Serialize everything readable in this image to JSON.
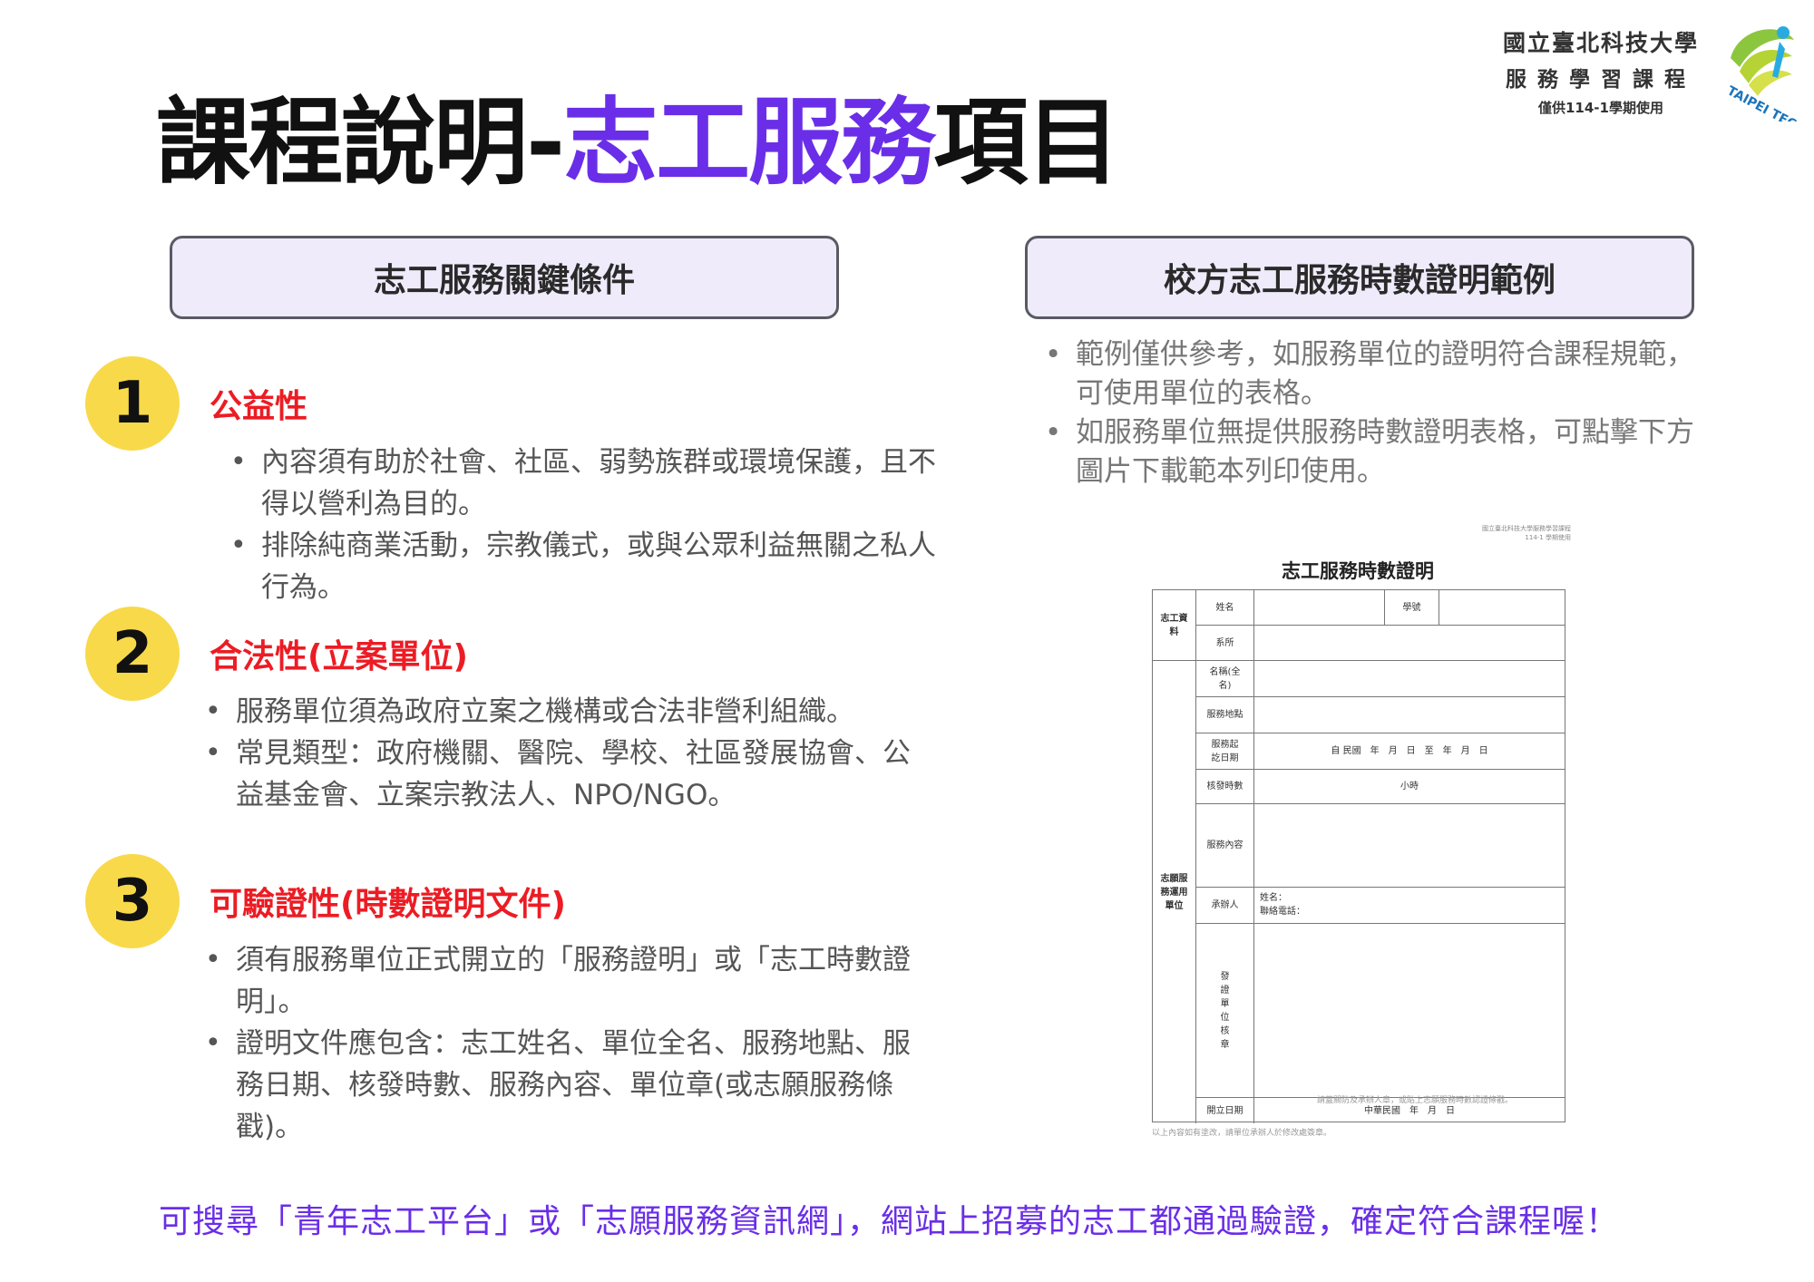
{
  "logo": {
    "line1": "國立臺北科技大學",
    "line2": "服務學習課程",
    "line3": "僅供114-1學期使用",
    "brand": "TAIPEI TECH"
  },
  "title": {
    "part1": "課程說明-",
    "part2": "志工服務",
    "part3": "項目"
  },
  "left_header": "志工服務關鍵條件",
  "right_header": "校方志工服務時數證明範例",
  "items": [
    {
      "number": "1",
      "title": "公益性",
      "bullets": [
        "內容須有助於社會、社區、弱勢族群或環境保護，且不得以營利為目的。",
        "排除純商業活動，宗教儀式，或與公眾利益無關之私人行為。"
      ]
    },
    {
      "number": "2",
      "title": "合法性(立案單位)",
      "bullets": [
        "服務單位須為政府立案之機構或合法非營利組織。",
        "常見類型：政府機關、醫院、學校、社區發展協會、公益基金會、立案宗教法人、NPO/NGO。"
      ]
    },
    {
      "number": "3",
      "title": "可驗證性(時數證明文件)",
      "bullets": [
        "須有服務單位正式開立的「服務證明」或「志工時數證明」。",
        "證明文件應包含：志工姓名、單位全名、服務地點、服務日期、核發時數、服務內容、單位章(或志願服務條戳)。"
      ]
    }
  ],
  "notes": [
    "範例僅供參考，如服務單位的證明符合課程規範，可使用單位的表格。",
    "如服務單位無提供服務時數證明表格，可點擊下方圖片下載範本列印使用。"
  ],
  "certificate": {
    "corner_line1": "國立臺北科技大學服務學習課程",
    "corner_line2": "114-1 學期使用",
    "title": "志工服務時數證明",
    "section_volunteer": "志工資料",
    "section_unit": "志願服務運用單位",
    "name_label": "姓名",
    "student_id_label": "學號",
    "dept_label": "系所",
    "unit_name_label": "名稱(全名)",
    "location_label": "服務地點",
    "dates_label": "服務起訖日期",
    "dates_value": "自 民國　年　月　日　至　年　月　日",
    "hours_label": "核發時數",
    "hours_value": "小時",
    "content_label": "服務內容",
    "contact_label": "承辦人",
    "contact_value1": "姓名：",
    "contact_value2": "聯絡電話：",
    "seal_label": "發證單位核章",
    "seal_note": "請蓋關防及承辦人章，或貼上志願服務時數認證條戳。",
    "issue_date_label": "開立日期",
    "issue_date_value": "中華民國　年　月　日",
    "footer": "以上內容如有塗改，請單位承辦人於修改處簽章。"
  },
  "bottom_text": "可搜尋「青年志工平台」或「志願服務資訊網」，網站上招募的志工都通過驗證，確定符合課程喔！",
  "colors": {
    "accent_purple": "#6a2ee8",
    "item_red": "#ec1c24",
    "number_yellow": "#f8d94a",
    "header_bg": "#efebfb"
  }
}
